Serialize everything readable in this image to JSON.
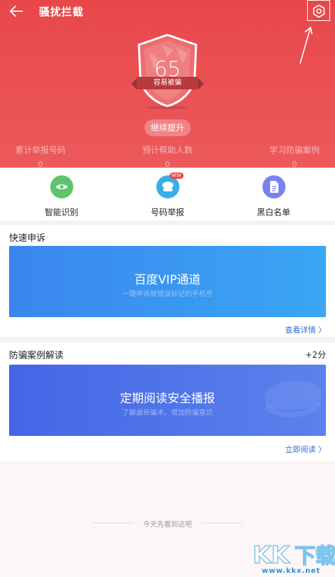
{
  "header": {
    "title": "骚扰拦截",
    "score": "65",
    "score_label": "容易被骗",
    "improve_button": "继续提升",
    "stats": [
      {
        "label": "累计举报号码",
        "value": "0"
      },
      {
        "label": "预计帮助人数",
        "value": "0"
      },
      {
        "label": "学习防骗案例",
        "value": "0"
      }
    ]
  },
  "quick_actions": [
    {
      "label": "智能识别",
      "icon": "eye-icon",
      "color": "#5fc46e"
    },
    {
      "label": "号码举报",
      "icon": "phone-report-icon",
      "color": "#39aee9",
      "badge": "NEW"
    },
    {
      "label": "黑白名单",
      "icon": "list-document-icon",
      "color": "#7a82f0"
    }
  ],
  "complaint": {
    "title": "快速申诉",
    "banner_title": "百度VIP通道",
    "banner_subtitle": "一键申诉被错误标记的手机号",
    "link": "查看详情 〉"
  },
  "cases": {
    "title": "防骗案例解读",
    "points": "+2分",
    "banner_title": "定期阅读安全播报",
    "banner_subtitle": "了解最新骗术，增加防骗意识",
    "link": "立即阅读 〉"
  },
  "footer": {
    "end_text": "今天先看到这吧"
  },
  "watermark": {
    "text": "KK下载",
    "url": "www.kkx.net"
  },
  "colors": {
    "header_red": "#e8474a",
    "link_blue": "#2f6ed8",
    "banner1": "#3a8df0",
    "banner2": "#4a6ee8"
  }
}
